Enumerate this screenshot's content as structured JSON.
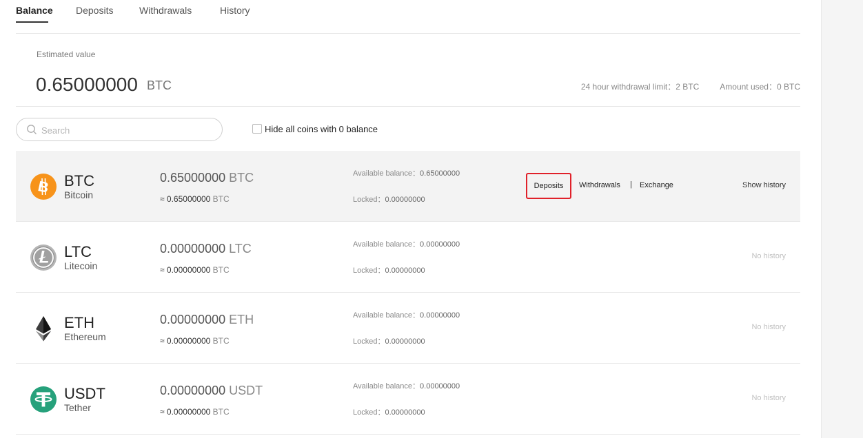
{
  "tabs": {
    "balance": "Balance",
    "deposits": "Deposits",
    "withdrawals": "Withdrawals",
    "history": "History"
  },
  "estimate": {
    "label": "Estimated value",
    "value": "0.65000000",
    "unit": "BTC",
    "limit_label": "24 hour withdrawal limit：",
    "limit_value": "2 BTC",
    "used_label": "Amount used：",
    "used_value": "0 BTC"
  },
  "search": {
    "placeholder": "Search"
  },
  "hide_zero_label": "Hide all coins with 0 balance",
  "coins": [
    {
      "symbol": "BTC",
      "name": "Bitcoin",
      "amount": "0.65000000",
      "unit": "BTC",
      "btc_equiv": "≈ 0.65000000",
      "btc_unit": "BTC",
      "available_label": "Available balance：",
      "available": "0.65000000",
      "locked_label": "Locked：",
      "locked": "0.00000000",
      "deposit": "Deposits",
      "withdraw": "Withdrawals",
      "separator": "|",
      "exchange": "Exchange",
      "history": "Show history",
      "color": "#f7931a"
    },
    {
      "symbol": "LTC",
      "name": "Litecoin",
      "amount": "0.00000000",
      "unit": "LTC",
      "btc_equiv": "≈ 0.00000000",
      "btc_unit": "BTC",
      "available_label": "Available balance：",
      "available": "0.00000000",
      "locked_label": "Locked：",
      "locked": "0.00000000",
      "history": "No history",
      "color": "#9a9a9a"
    },
    {
      "symbol": "ETH",
      "name": "Ethereum",
      "amount": "0.00000000",
      "unit": "ETH",
      "btc_equiv": "≈ 0.00000000",
      "btc_unit": "BTC",
      "available_label": "Available balance：",
      "available": "0.00000000",
      "locked_label": "Locked：",
      "locked": "0.00000000",
      "history": "No history",
      "color": "#3c3c3d"
    },
    {
      "symbol": "USDT",
      "name": "Tether",
      "amount": "0.00000000",
      "unit": "USDT",
      "btc_equiv": "≈ 0.00000000",
      "btc_unit": "BTC",
      "available_label": "Available balance：",
      "available": "0.00000000",
      "locked_label": "Locked：",
      "locked": "0.00000000",
      "history": "No history",
      "color": "#26a17b"
    }
  ]
}
